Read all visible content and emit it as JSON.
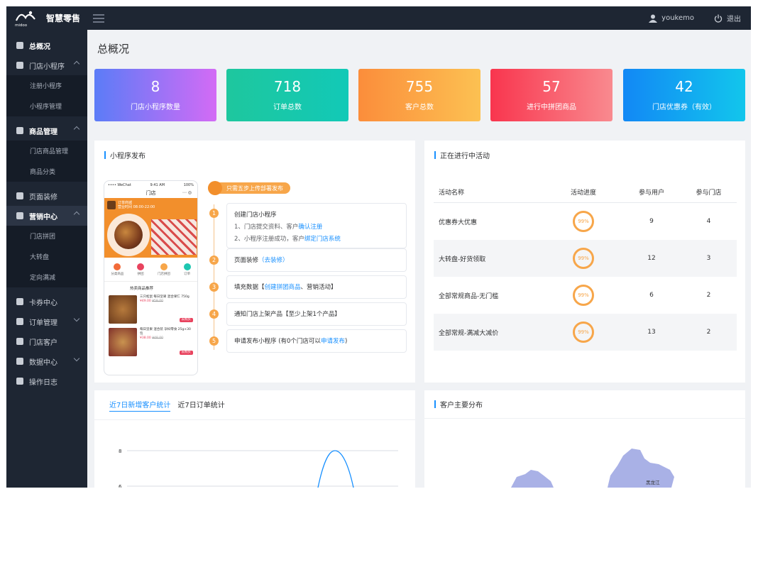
{
  "brand": {
    "sub": "midoo",
    "name": "智慧零售"
  },
  "topbar": {
    "username": "youkemo",
    "logout": "退出"
  },
  "sidebar": {
    "items": [
      {
        "label": "总概况"
      },
      {
        "label": "门店小程序"
      },
      {
        "label": "商品管理"
      },
      {
        "label": "页面装修"
      },
      {
        "label": "营销中心"
      },
      {
        "label": "卡券中心"
      },
      {
        "label": "订单管理"
      },
      {
        "label": "门店客户"
      },
      {
        "label": "数据中心"
      },
      {
        "label": "操作日志"
      }
    ],
    "sub_miniprogram": [
      "注册小程序",
      "小程序管理"
    ],
    "sub_goods": [
      "门店商品管理",
      "商品分类"
    ],
    "sub_marketing": [
      "门店拼团",
      "大转盘",
      "定向满减"
    ]
  },
  "page": {
    "title": "总概况"
  },
  "stats": [
    {
      "value": "8",
      "label": "门店小程序数量"
    },
    {
      "value": "718",
      "label": "订单总数"
    },
    {
      "value": "755",
      "label": "客户总数"
    },
    {
      "value": "57",
      "label": "进行中拼团商品"
    },
    {
      "value": "42",
      "label": "门店优惠券（有效）"
    }
  ],
  "publish": {
    "title": "小程序发布",
    "badge": "只需五步上传部署发布",
    "phone": {
      "carrier": "•••• WeChat",
      "time": "9:41 AM",
      "battery": "100%",
      "title": "门店",
      "shop_name": "订单商城",
      "shop_note": "营业时间 08:00-22:00",
      "nav": [
        "分类商品",
        "拼团",
        "门店拼团",
        "订单"
      ],
      "section": "热卖商品推荐",
      "products": [
        {
          "name": "三只松鼠 每日坚果 混合果仁 750g",
          "price": "¥49.00",
          "old": "¥59.00",
          "btn": "去购买"
        },
        {
          "name": "每日坚果 混合装 孕妇零食 25g×30包",
          "price": "¥38.00",
          "old": "¥48.00",
          "btn": "去购买"
        }
      ]
    },
    "steps": [
      {
        "num": "1",
        "title": "创建门店小程序",
        "lines": [
          {
            "text": "1、门店提交资料、客户",
            "link": "确认注册"
          },
          {
            "text": "2、小程序注册成功，客户",
            "link": "绑定门店系统"
          }
        ]
      },
      {
        "num": "2",
        "text": "页面装修",
        "link": "（去装修）"
      },
      {
        "num": "3",
        "text": "填充数据【",
        "link": "创建拼团商品",
        "tail": "、营销活动】"
      },
      {
        "num": "4",
        "text": "通知门店上架产品【至少上架1个产品】"
      },
      {
        "num": "5",
        "text": "申请发布小程序 (有0个门店可以",
        "link": "申请发布",
        "tail": ")"
      }
    ]
  },
  "activities": {
    "title": "正在进行中活动",
    "headers": [
      "活动名称",
      "活动进度",
      "参与用户",
      "参与门店"
    ],
    "rows": [
      {
        "name": "优惠券大优惠",
        "progress": "99%",
        "users": "9",
        "stores": "4"
      },
      {
        "name": "大转盘-好货领取",
        "progress": "99%",
        "users": "12",
        "stores": "3"
      },
      {
        "name": "全部常规商品-无门槛",
        "progress": "99%",
        "users": "6",
        "stores": "2"
      },
      {
        "name": "全部常规-满减大减价",
        "progress": "99%",
        "users": "13",
        "stores": "2"
      }
    ]
  },
  "trend": {
    "tabs": [
      "近7日新增客户统计",
      "近7日订单统计"
    ],
    "y_labels": [
      "8",
      "6"
    ]
  },
  "distribution": {
    "title": "客户主要分布",
    "map_label": "黑龙江"
  },
  "colors": {
    "sidebar": "#1e2633",
    "accent": "#1890ff",
    "orange": "#f7a64a"
  }
}
